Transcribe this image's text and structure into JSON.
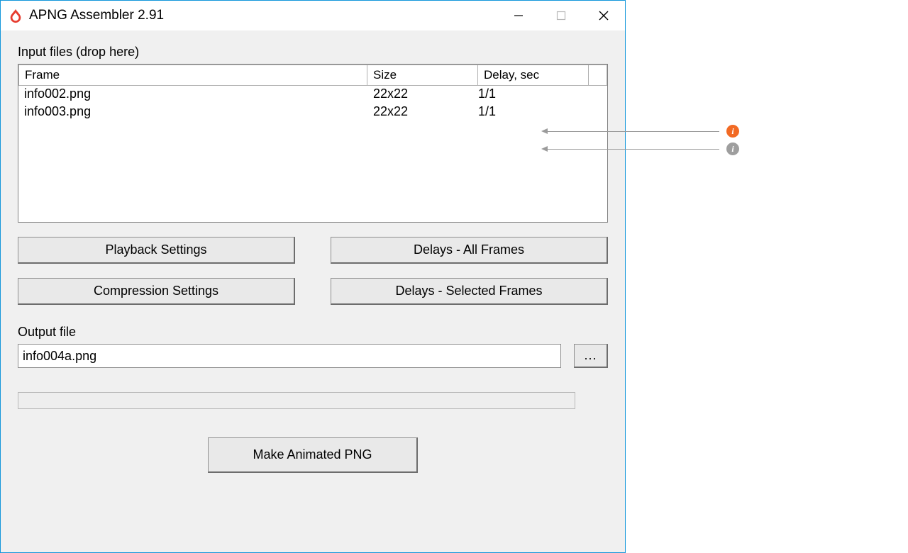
{
  "window": {
    "title": "APNG Assembler 2.91"
  },
  "labels": {
    "input_files": "Input files (drop here)",
    "output_file": "Output file"
  },
  "columns": {
    "frame": "Frame",
    "size": "Size",
    "delay": "Delay, sec"
  },
  "rows": [
    {
      "frame": "info002.png",
      "size": "22x22",
      "delay": "1/1"
    },
    {
      "frame": "info003.png",
      "size": "22x22",
      "delay": "1/1"
    }
  ],
  "buttons": {
    "playback": "Playback Settings",
    "compression": "Compression Settings",
    "delays_all": "Delays - All Frames",
    "delays_sel": "Delays - Selected Frames",
    "browse": "...",
    "make": "Make Animated PNG"
  },
  "output": {
    "value": "info004a.png"
  },
  "annotations": [
    {
      "badge": "i",
      "color": "orange"
    },
    {
      "badge": "i",
      "color": "gray"
    }
  ]
}
